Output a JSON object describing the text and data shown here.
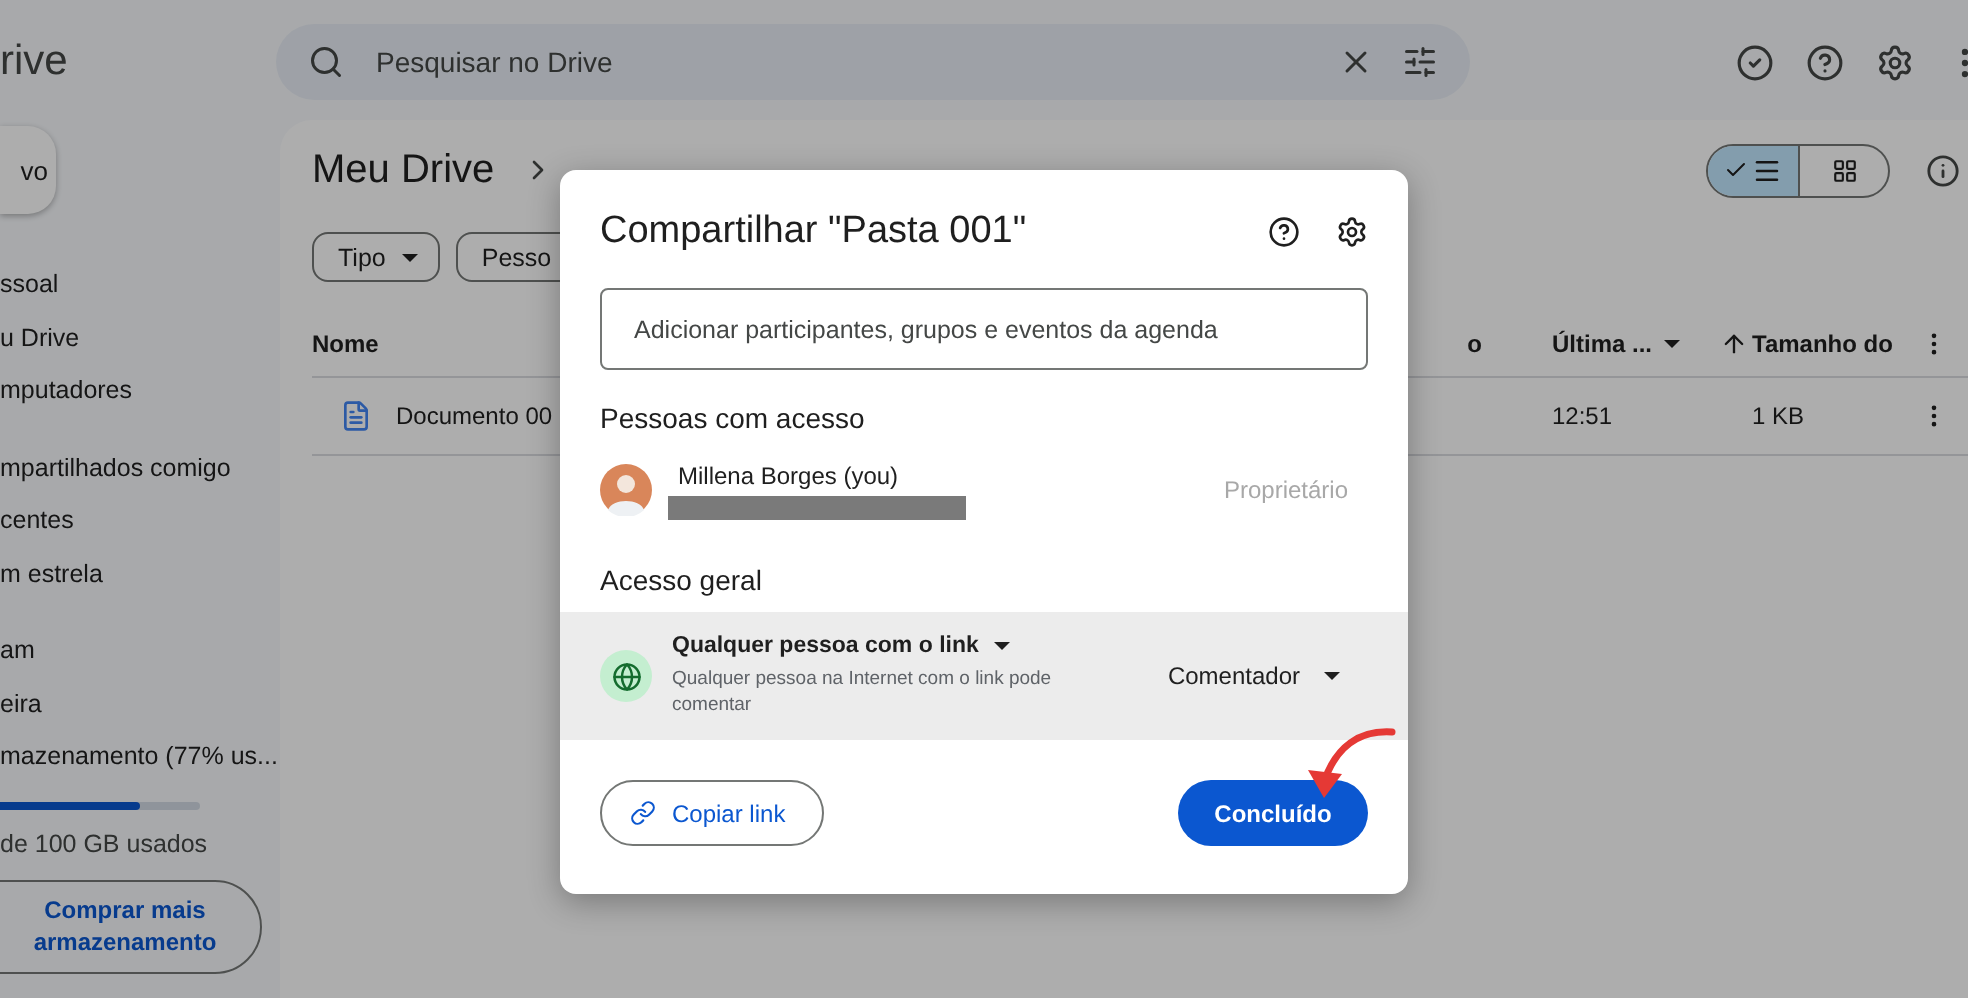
{
  "top_bar": {
    "app_title": "rive",
    "search": {
      "placeholder": "Pesquisar no Drive"
    }
  },
  "sidebar": {
    "new_button": "vo",
    "groups": [
      {
        "items": [
          {
            "label": "ssoal"
          },
          {
            "label": "u Drive"
          },
          {
            "label": "mputadores"
          }
        ]
      },
      {
        "items": [
          {
            "label": "mpartilhados comigo"
          },
          {
            "label": "centes"
          },
          {
            "label": "m estrela"
          }
        ]
      },
      {
        "items": [
          {
            "label": "am"
          },
          {
            "label": "eira"
          },
          {
            "label": "mazenamento (77% us..."
          }
        ]
      }
    ],
    "storage": {
      "level": 0.77,
      "usage": "de 100 GB usados",
      "buy_button": "Comprar mais armazenamento"
    }
  },
  "main": {
    "breadcrumb": [
      "Meu Drive"
    ],
    "view_toggle": [
      {
        "kind": "list",
        "selected": true
      },
      {
        "kind": "grid",
        "selected": false
      }
    ],
    "filters": [
      "Tipo",
      "Pesso"
    ],
    "table": {
      "columns": [
        "Nome",
        "o",
        "Última ...",
        "Tamanho do"
      ],
      "rows": [
        {
          "name": "Documento 00",
          "modified": "12:51",
          "size": "1 KB"
        }
      ]
    }
  },
  "dialog": {
    "title": "Compartilhar \"Pasta 001\"",
    "input": {
      "placeholder": "Adicionar participantes, grupos e eventos da agenda"
    },
    "people_heading": "Pessoas com acesso",
    "people": [
      {
        "name": "Millena Borges (you)",
        "role": "Proprietário"
      }
    ],
    "general_heading": "Acesso geral",
    "general_access": {
      "scope": "Qualquer pessoa com o link",
      "description": "Qualquer pessoa na Internet com o link pode comentar",
      "role": "Comentador"
    },
    "copy_button": "Copiar link",
    "done_button": "Concluído"
  }
}
